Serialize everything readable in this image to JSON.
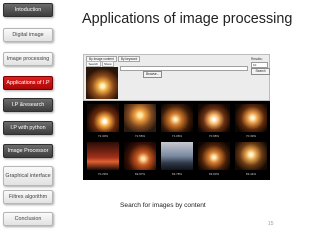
{
  "nav": {
    "items": [
      {
        "label": "Intoduction",
        "style": "dark"
      },
      {
        "label": "Digital image",
        "style": "light"
      },
      {
        "label": "Image processing",
        "style": "light"
      },
      {
        "label": "Applications of I.P",
        "style": "active"
      },
      {
        "label": "I.P &research",
        "style": "dark"
      },
      {
        "label": "I.P with python",
        "style": "dark"
      },
      {
        "label": "Image Processor",
        "style": "dark"
      },
      {
        "label": "Graphical interface",
        "style": "light"
      },
      {
        "label": "Filtres algorithm",
        "style": "light"
      },
      {
        "label": "Conclusion",
        "style": "light"
      }
    ]
  },
  "title": "Applications of image processing",
  "app": {
    "tabs": [
      "By Image content",
      "By keyword"
    ],
    "subtabs": [
      "Search",
      "Show"
    ],
    "browse_label": "Browse...",
    "results_label": "Results:",
    "results_value": "10",
    "search_label": "Search"
  },
  "results": [
    {
      "score": "72.30%"
    },
    {
      "score": "72.56%"
    },
    {
      "score": "71.06%"
    },
    {
      "score": "70.68%"
    },
    {
      "score": "70.39%"
    },
    {
      "score": "70.29%"
    },
    {
      "score": "69.97%"
    },
    {
      "score": "69.78%"
    },
    {
      "score": "69.63%"
    },
    {
      "score": "69.44%"
    }
  ],
  "caption": "Search for images by content",
  "page_number": "15",
  "colors": {
    "active_nav": "#c61010",
    "dark_nav": "#555555",
    "title": "#222222"
  }
}
